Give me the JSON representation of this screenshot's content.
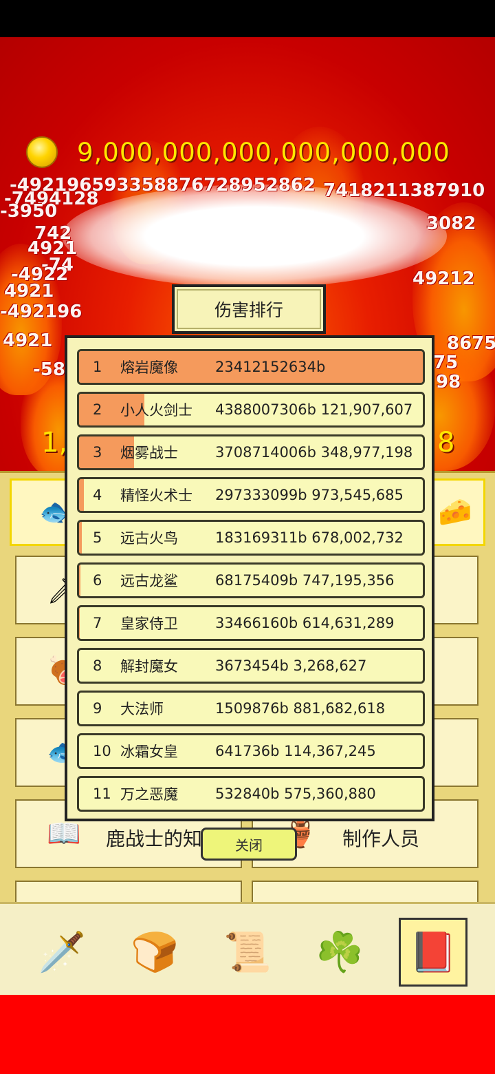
{
  "gold": {
    "icon": "gold-coin-icon",
    "amount": "9,000,000,000,000,000,000"
  },
  "damage_floaters": [
    "-492196593358876728952862",
    "-7494128",
    "-3950",
    "7418211387910",
    "3082",
    "742",
    "4921",
    "-74",
    "-4922",
    "4921",
    "-492196",
    "49212",
    "4921",
    "-58",
    "8675",
    "75",
    "98"
  ],
  "background_side_numbers": {
    "left": "1,",
    "right": "8"
  },
  "game_menu": {
    "tile_knowledge_label": "鹿战士的知",
    "tile_credits_label": "制作人员"
  },
  "ranking_dialog": {
    "title": "伤害排行",
    "rows": [
      {
        "rank": "1",
        "name": "熔岩魔像",
        "value": "23412152634b",
        "fill": 1.0
      },
      {
        "rank": "2",
        "name": "小人火剑士",
        "value": "4388007306b 121,907,607",
        "fill": 0.19
      },
      {
        "rank": "3",
        "name": "烟雾战士",
        "value": "3708714006b 348,977,198",
        "fill": 0.16
      },
      {
        "rank": "4",
        "name": "精怪火术士",
        "value": "297333099b 973,545,685",
        "fill": 0.013
      },
      {
        "rank": "5",
        "name": "远古火鸟",
        "value": "183169311b 678,002,732",
        "fill": 0.008
      },
      {
        "rank": "6",
        "name": "远古龙鲨",
        "value": "68175409b 747,195,356",
        "fill": 0.003
      },
      {
        "rank": "7",
        "name": "皇家侍卫",
        "value": "33466160b 614,631,289",
        "fill": 0.001
      },
      {
        "rank": "8",
        "name": "解封魔女",
        "value": "3673454b 3,268,627",
        "fill": 0
      },
      {
        "rank": "9",
        "name": "大法师",
        "value": "1509876b 881,682,618",
        "fill": 0
      },
      {
        "rank": "10",
        "name": "冰霜女皇",
        "value": "641736b 114,367,245",
        "fill": 0
      },
      {
        "rank": "11",
        "name": "万之恶魔",
        "value": "532840b 575,360,880",
        "fill": 0
      }
    ],
    "close_label": "关闭"
  },
  "bottom_nav": [
    {
      "icon": "sword-icon"
    },
    {
      "icon": "bread-icon"
    },
    {
      "icon": "scroll-icon"
    },
    {
      "icon": "clover-icon"
    },
    {
      "icon": "book-icon",
      "active": true
    }
  ],
  "colors": {
    "bar_fill": "#f59a5c",
    "dialog_bg": "#f7f3b8",
    "gold_text": "#ffe800"
  }
}
